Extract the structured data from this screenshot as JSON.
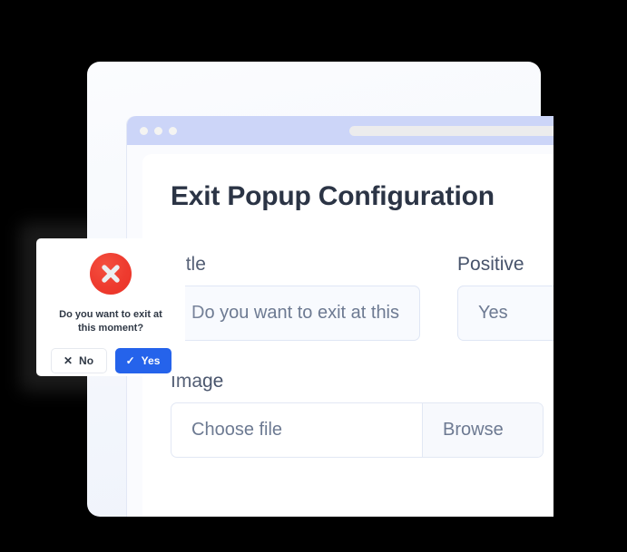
{
  "browser": {
    "dots": [
      "dot-1",
      "dot-2",
      "dot-3"
    ],
    "address_bar_value": ""
  },
  "page": {
    "title": "Exit Popup Configuration"
  },
  "form": {
    "fields": [
      {
        "name": "title",
        "label": "Title",
        "value": "Do you want to exit at this"
      },
      {
        "name": "positive",
        "label": "Positive",
        "value": "Yes"
      },
      {
        "name": "image",
        "label": "Image",
        "value": "Choose file",
        "browse_label": "Browse"
      }
    ]
  },
  "dialog": {
    "icon": "error-circle-x-icon",
    "icon_color": "#ea3326",
    "message": "Do you want to exit at this moment?",
    "buttons": [
      {
        "name": "no",
        "label": "No",
        "glyph": "✕",
        "style": "secondary",
        "color": "#ffffff"
      },
      {
        "name": "yes",
        "label": "Yes",
        "glyph": "✓",
        "style": "primary",
        "color": "#2563eb"
      }
    ]
  },
  "colors": {
    "accent": "#2563eb",
    "danger": "#ea3326",
    "titlebar": "#ccd5f8",
    "input_bg": "#f8fafe",
    "input_border": "#dfe6f5"
  }
}
